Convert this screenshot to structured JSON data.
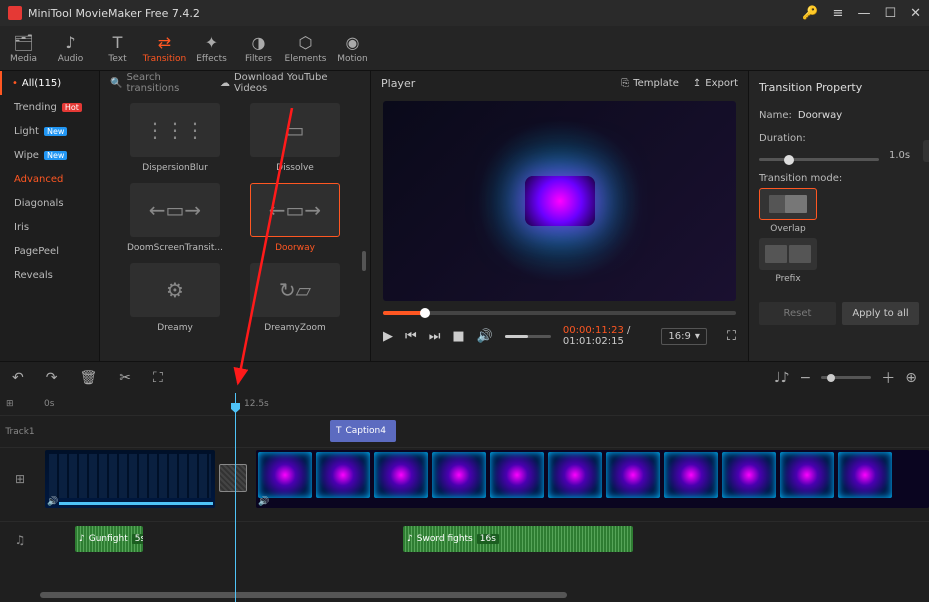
{
  "app": {
    "title": "MiniTool MovieMaker Free 7.4.2"
  },
  "toolbar": {
    "tabs": [
      "Media",
      "Audio",
      "Text",
      "Transition",
      "Effects",
      "Filters",
      "Elements",
      "Motion"
    ]
  },
  "sidebar": {
    "all": "All(115)",
    "cats": [
      {
        "label": "Trending",
        "badge": "Hot",
        "bclass": "hot"
      },
      {
        "label": "Light",
        "badge": "New",
        "bclass": "new"
      },
      {
        "label": "Wipe",
        "badge": "New",
        "bclass": "new"
      },
      {
        "label": "Advanced",
        "active": true
      },
      {
        "label": "Diagonals"
      },
      {
        "label": "Iris"
      },
      {
        "label": "PagePeel"
      },
      {
        "label": "Reveals"
      }
    ]
  },
  "trans": {
    "search_placeholder": "Search transitions",
    "download": "Download YouTube Videos",
    "items": [
      "DispersionBlur",
      "Dissolve",
      "DoomScreenTransit...",
      "Doorway",
      "Dreamy",
      "DreamyZoom"
    ],
    "selected_index": 3
  },
  "player": {
    "title": "Player",
    "template": "Template",
    "export": "Export",
    "cur_time": "00:00:11:23",
    "total_time": "01:01:02:15",
    "ratio": "16:9"
  },
  "props": {
    "title": "Transition Property",
    "name_label": "Name:",
    "name_value": "Doorway",
    "duration_label": "Duration:",
    "duration_value": "1.0s",
    "mode_label": "Transition mode:",
    "mode_overlap": "Overlap",
    "mode_prefix": "Prefix",
    "reset": "Reset",
    "apply": "Apply to all"
  },
  "timeline": {
    "ruler": {
      "zero": "0s",
      "mark": "12.5s"
    },
    "track1": "Track1",
    "caption": "Caption4",
    "audio1": {
      "name": "Gunfight",
      "dur": "5s"
    },
    "audio2": {
      "name": "Sword fights",
      "dur": "16s"
    }
  }
}
